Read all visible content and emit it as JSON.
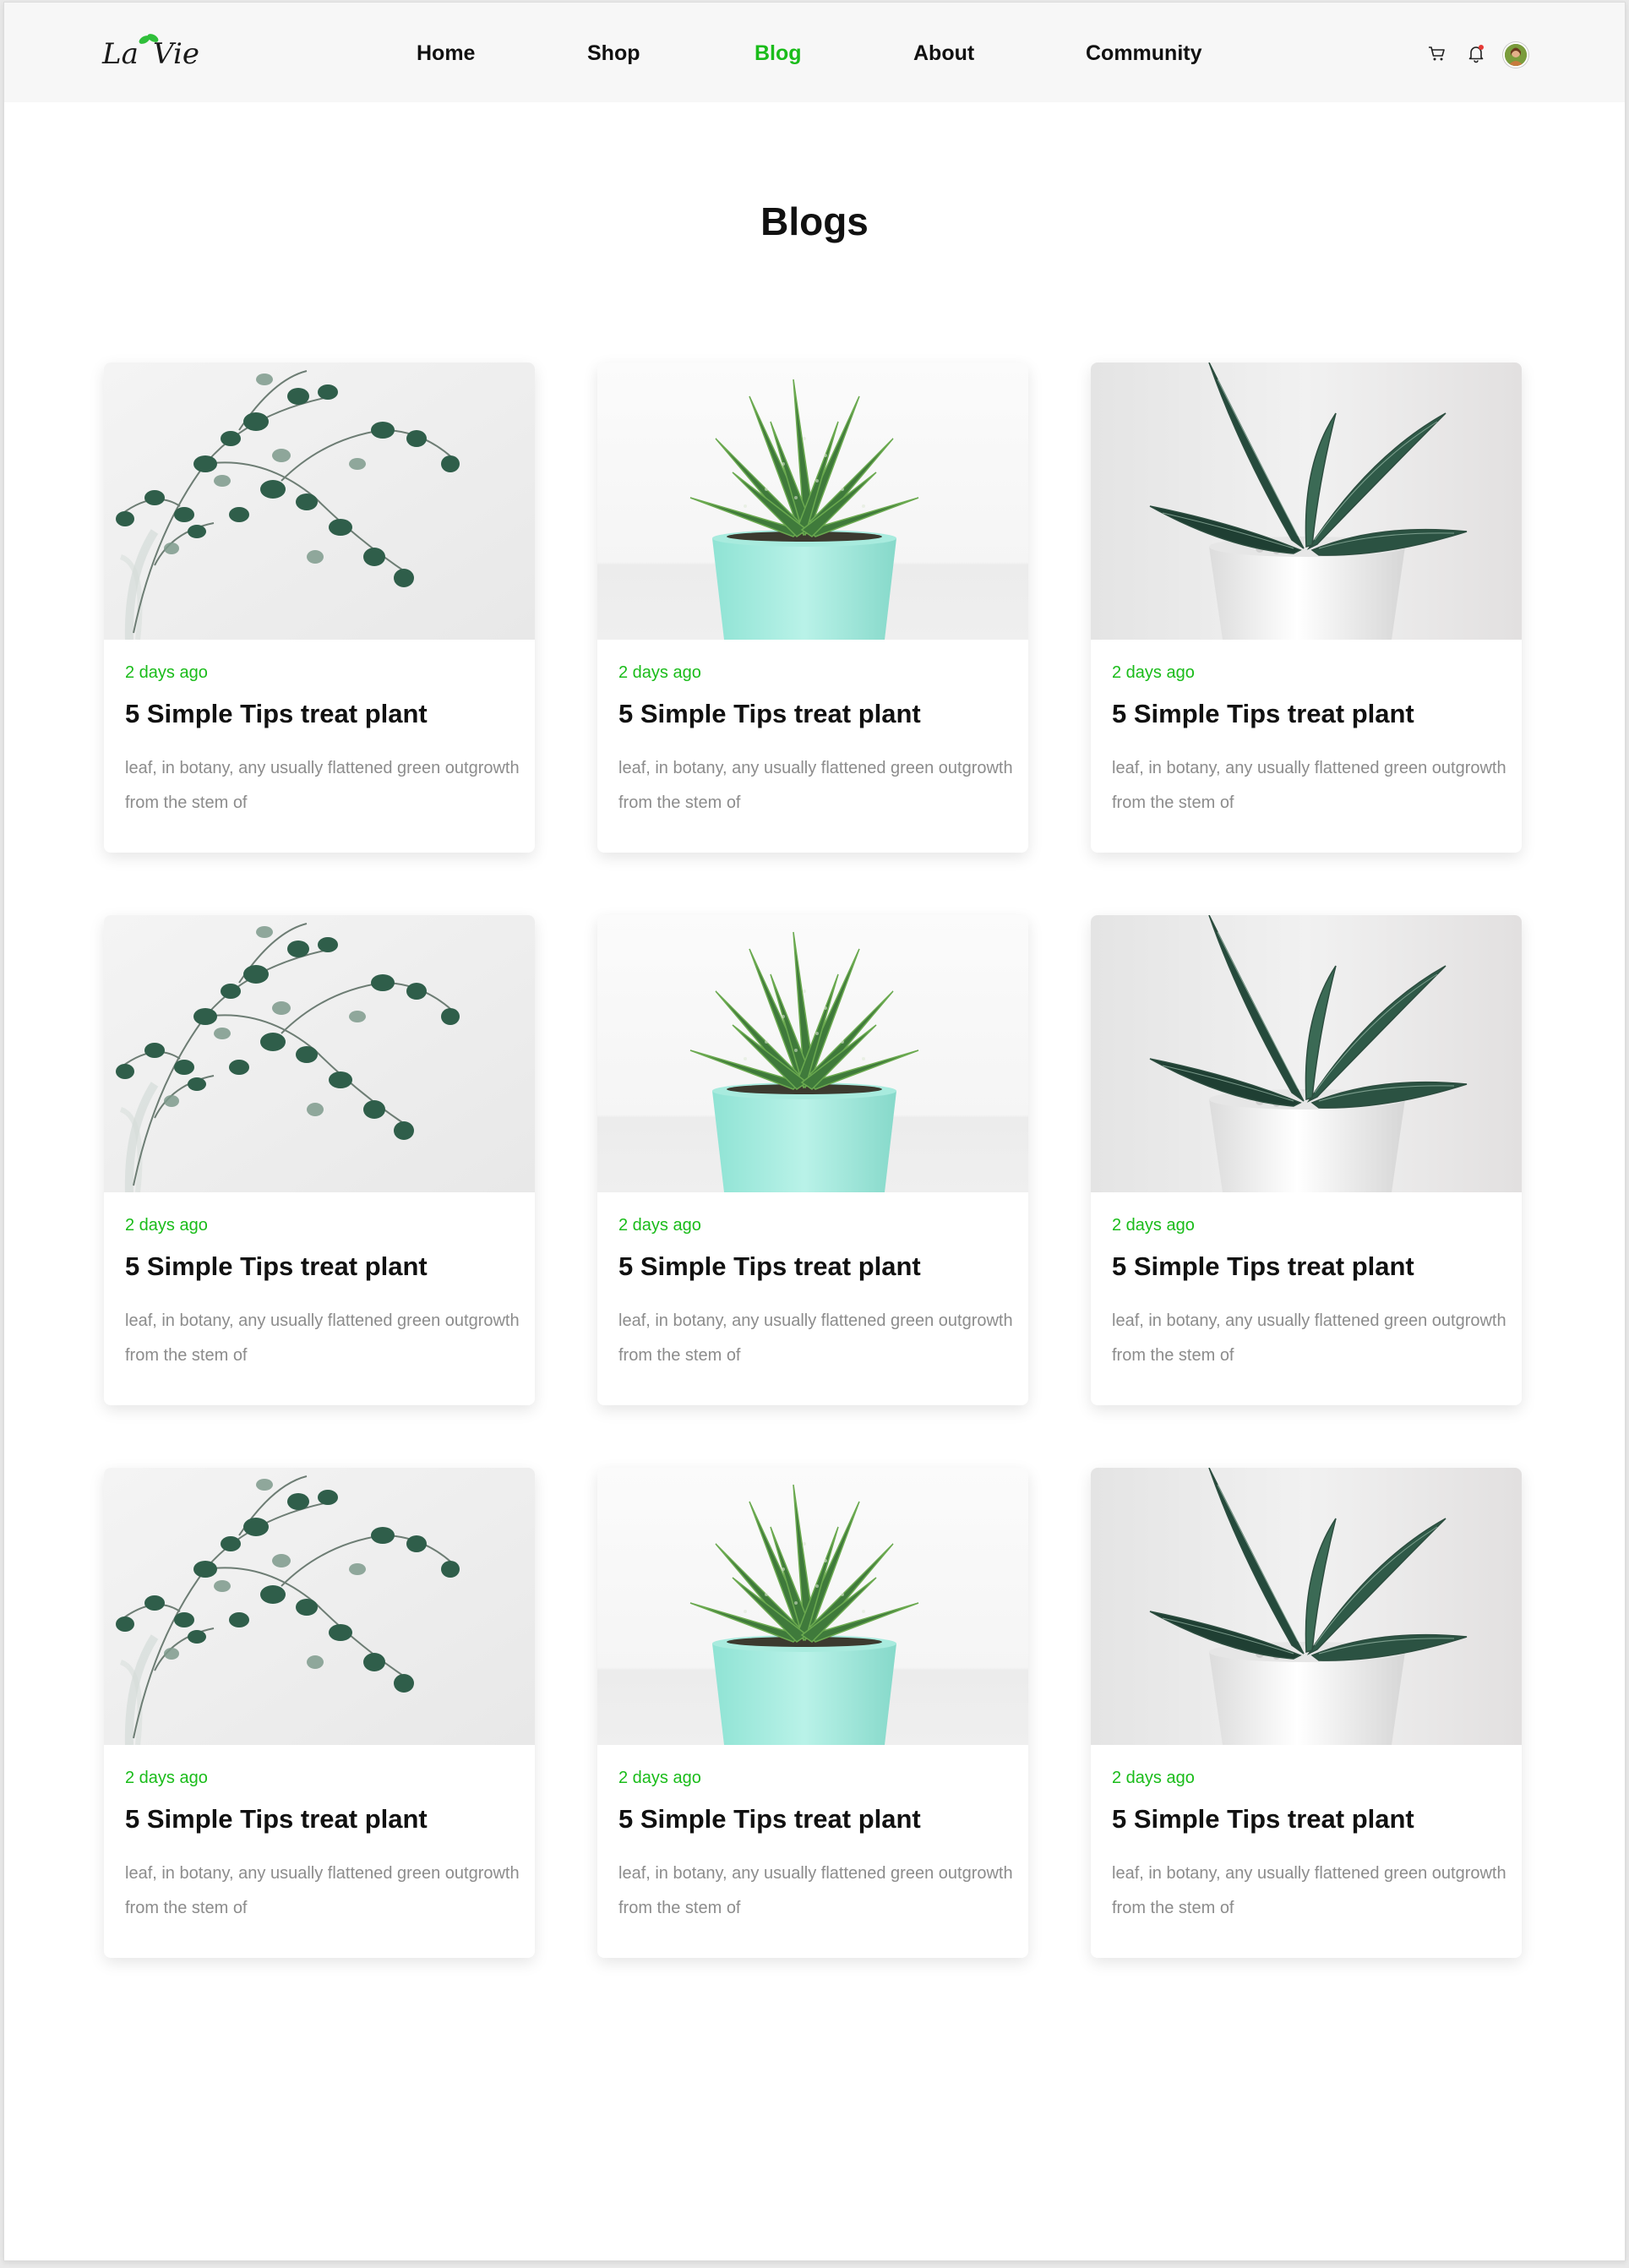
{
  "header": {
    "logo_text": "La Vie",
    "nav": [
      {
        "label": "Home"
      },
      {
        "label": "Shop"
      },
      {
        "label": "Blog"
      },
      {
        "label": "About"
      },
      {
        "label": "Community"
      }
    ],
    "active_nav": "Blog",
    "accent_color": "#1abc1a",
    "icons": [
      "cart-icon",
      "bell-icon",
      "avatar"
    ]
  },
  "page": {
    "title": "Blogs"
  },
  "cards": [
    {
      "image": "eucalyptus-plant",
      "date": "2 days ago",
      "title": "5 Simple Tips treat plant",
      "desc": "leaf, in botany, any usually flattened green outgrowth from the stem of"
    },
    {
      "image": "haworthia-mint-pot",
      "date": "2 days ago",
      "title": "5 Simple Tips treat plant",
      "desc": "leaf, in botany, any usually flattened green outgrowth from the stem of"
    },
    {
      "image": "snake-plant-white-pot",
      "date": "2 days ago",
      "title": "5 Simple Tips treat plant",
      "desc": "leaf, in botany, any usually flattened green outgrowth from the stem of"
    },
    {
      "image": "eucalyptus-plant",
      "date": "2 days ago",
      "title": "5 Simple Tips treat plant",
      "desc": "leaf, in botany, any usually flattened green outgrowth from the stem of"
    },
    {
      "image": "haworthia-mint-pot",
      "date": "2 days ago",
      "title": "5 Simple Tips treat plant",
      "desc": "leaf, in botany, any usually flattened green outgrowth from the stem of"
    },
    {
      "image": "snake-plant-white-pot",
      "date": "2 days ago",
      "title": "5 Simple Tips treat plant",
      "desc": "leaf, in botany, any usually flattened green outgrowth from the stem of"
    },
    {
      "image": "eucalyptus-plant",
      "date": "2 days ago",
      "title": "5 Simple Tips treat plant",
      "desc": "leaf, in botany, any usually flattened green outgrowth from the stem of"
    },
    {
      "image": "haworthia-mint-pot",
      "date": "2 days ago",
      "title": "5 Simple Tips treat plant",
      "desc": "leaf, in botany, any usually flattened green outgrowth from the stem of"
    },
    {
      "image": "snake-plant-white-pot",
      "date": "2 days ago",
      "title": "5 Simple Tips treat plant",
      "desc": "leaf, in botany, any usually flattened green outgrowth from the stem of"
    }
  ]
}
